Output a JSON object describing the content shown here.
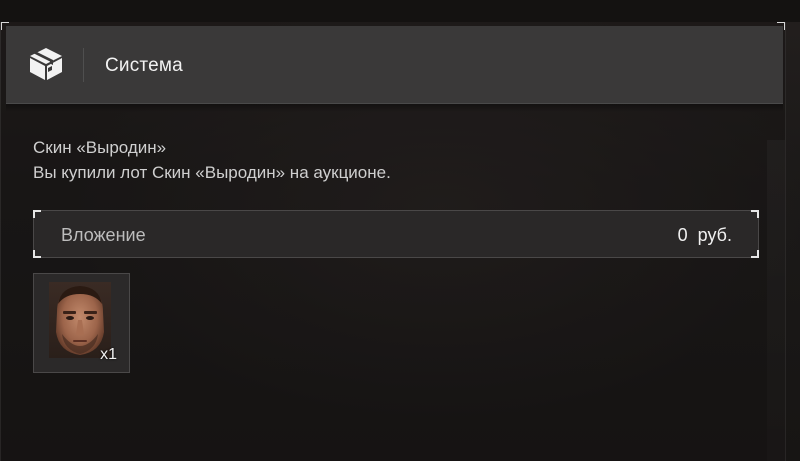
{
  "header": {
    "title": "Система",
    "icon": "box-icon"
  },
  "message": {
    "title": "Скин «Выродин»",
    "body": "Вы купили лот Скин «Выродин» на аукционе."
  },
  "attachment": {
    "label": "Вложение",
    "value": "0  руб."
  },
  "item": {
    "name": "Скин «Выродин»",
    "icon": "face-portrait-icon",
    "quantity": "x1"
  },
  "colors": {
    "header_bg": "#3a3939",
    "text_primary": "#f2f2f2",
    "text_secondary": "#cfcfcf",
    "accent_corner": "#e6e6e6"
  }
}
